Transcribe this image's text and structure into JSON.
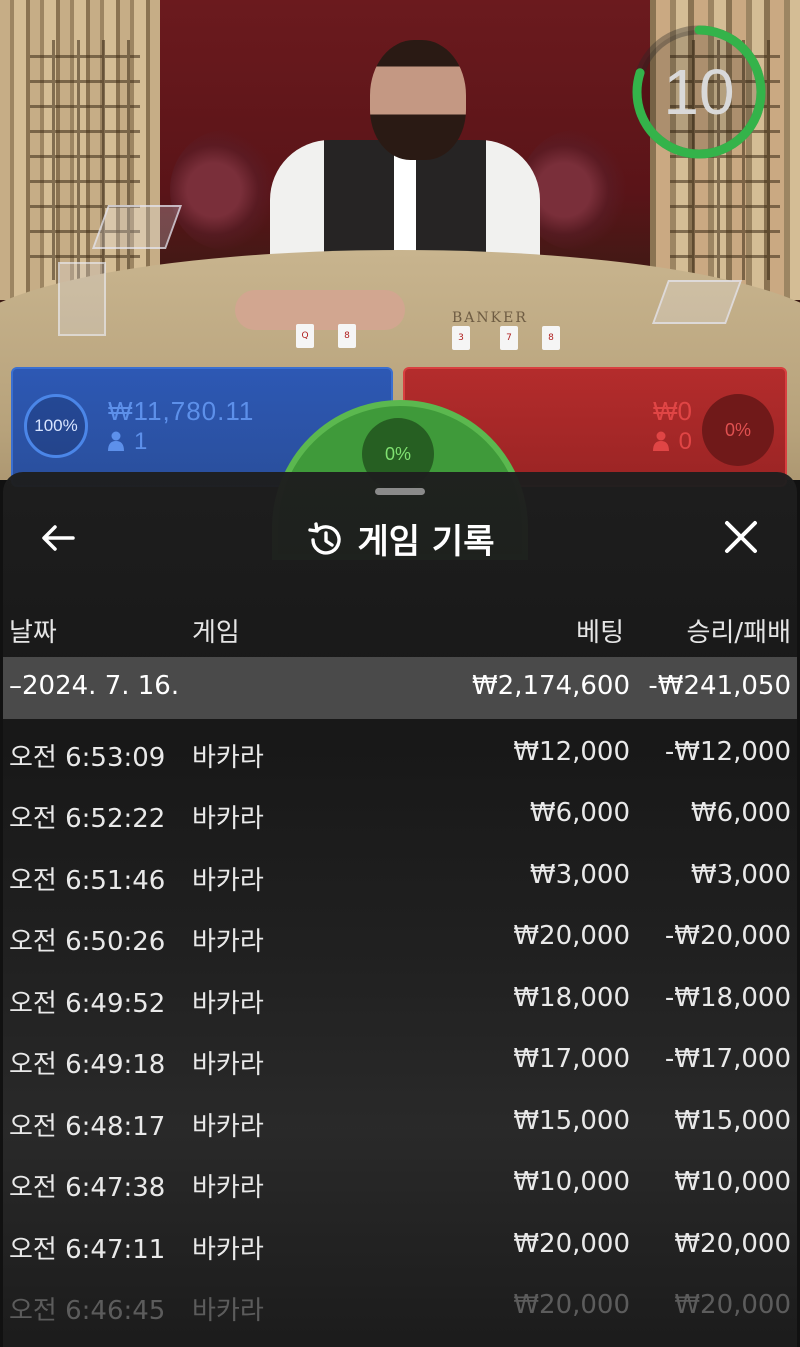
{
  "video": {
    "countdown": "10",
    "countdown_fraction": 0.8,
    "table_label": "BANKER",
    "player_cards": [
      "Q",
      "8"
    ],
    "banker_cards": [
      "3",
      "7",
      "8"
    ]
  },
  "bets": {
    "player": {
      "percent": "100%",
      "amount": "₩11,780.11",
      "count": "1"
    },
    "tie": {
      "percent": "0%"
    },
    "banker": {
      "percent": "0%",
      "amount": "₩0",
      "count": "0"
    }
  },
  "sheet": {
    "title": "게임 기록",
    "columns": {
      "date": "날짜",
      "game": "게임",
      "bet": "베팅",
      "win_loss": "승리/패배"
    },
    "date_group": {
      "label": "–2024. 7. 16.",
      "bet_total": "₩2,174,600",
      "win_loss_total": "-₩241,050"
    },
    "rows": [
      {
        "time": "오전 6:53:09",
        "game": "바카라",
        "bet": "₩12,000",
        "result": "-₩12,000"
      },
      {
        "time": "오전 6:52:22",
        "game": "바카라",
        "bet": "₩6,000",
        "result": "₩6,000"
      },
      {
        "time": "오전 6:51:46",
        "game": "바카라",
        "bet": "₩3,000",
        "result": "₩3,000"
      },
      {
        "time": "오전 6:50:26",
        "game": "바카라",
        "bet": "₩20,000",
        "result": "-₩20,000"
      },
      {
        "time": "오전 6:49:52",
        "game": "바카라",
        "bet": "₩18,000",
        "result": "-₩18,000"
      },
      {
        "time": "오전 6:49:18",
        "game": "바카라",
        "bet": "₩17,000",
        "result": "-₩17,000"
      },
      {
        "time": "오전 6:48:17",
        "game": "바카라",
        "bet": "₩15,000",
        "result": "₩15,000"
      },
      {
        "time": "오전 6:47:38",
        "game": "바카라",
        "bet": "₩10,000",
        "result": "₩10,000"
      },
      {
        "time": "오전 6:47:11",
        "game": "바카라",
        "bet": "₩20,000",
        "result": "₩20,000"
      },
      {
        "time": "오전 6:46:45",
        "game": "바카라",
        "bet": "₩20,000",
        "result": "₩20,000"
      }
    ]
  },
  "colors": {
    "player_blue": "#2d58b4",
    "banker_red": "#b42c2c",
    "tie_green": "#3f9a3a",
    "timer_green": "#34b34a"
  },
  "icons": {
    "back": "arrow-left-icon",
    "history": "history-icon",
    "close": "close-icon"
  }
}
